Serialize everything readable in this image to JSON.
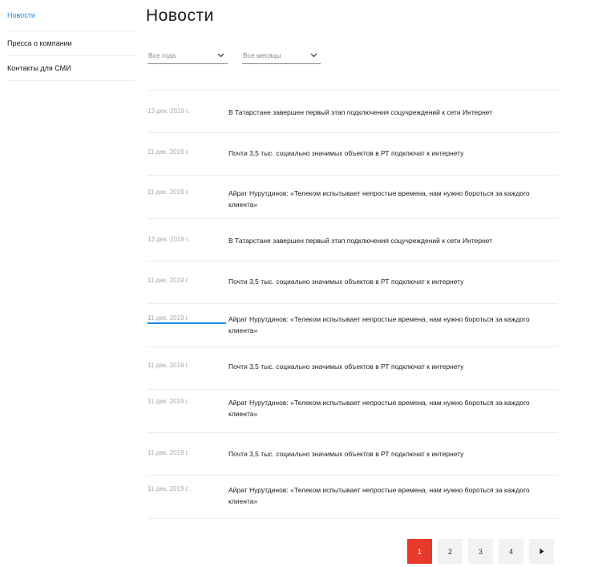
{
  "sidebar": {
    "items": [
      {
        "label": "Новости",
        "active": true
      },
      {
        "label": "Пресса о компании",
        "active": false
      },
      {
        "label": "Контакты для СМИ",
        "active": false
      }
    ]
  },
  "main": {
    "title": "Новости",
    "filters": {
      "year": "Все года",
      "month": "Все месяцы"
    },
    "news": [
      {
        "date": "13 дек. 2019 г.",
        "title": "В Татарстане завершен первый этап подключения соцучреждений к сети Интернет"
      },
      {
        "date": "11 дек. 2019 г.",
        "title": "Почти 3,5 тыс. социально значимых объектов в РТ подключат к интернету"
      },
      {
        "date": "11 дек. 2019 г.",
        "title": "Айрат Нурутдинов: «Телеком испытывает непростые времена, нам нужно бороться за каждого клиента»"
      },
      {
        "date": "13 дек. 2019 г.",
        "title": "В Татарстане завершен первый этап подключения соцучреждений к сети Интернет"
      },
      {
        "date": "11 дек. 2019 г.",
        "title": "Почти 3,5 тыс. социально значимых объектов в РТ подключат к интернету"
      },
      {
        "date": "11 дек. 2019 г.",
        "title": "Айрат Нурутдинов: «Телеком испытывает непростые времена, нам нужно бороться за каждого клиента»"
      },
      {
        "date": "11 дек. 2019 г.",
        "title": "Почти 3,5 тыс. социально значимых объектов в РТ подключат к интернету"
      },
      {
        "date": "11 дек. 2019 г.",
        "title": "Айрат Нурутдинов: «Телеком испытывает непростые времена, нам нужно бороться за каждого клиента»"
      },
      {
        "date": "11 дек. 2019 г.",
        "title": "Почти 3,5 тыс. социально значимых объектов в РТ подключат к интернету"
      },
      {
        "date": "11 дек. 2019 г.",
        "title": "Айрат Нурутдинов: «Телеком испытывает непростые времена, нам нужно бороться за каждого клиента»"
      }
    ]
  },
  "pagination": {
    "pages": [
      "1",
      "2",
      "3",
      "4"
    ],
    "current": "1",
    "next_icon": "play-right-icon"
  },
  "colors": {
    "accent": "#1e88e5",
    "active_page": "#e8392d"
  }
}
